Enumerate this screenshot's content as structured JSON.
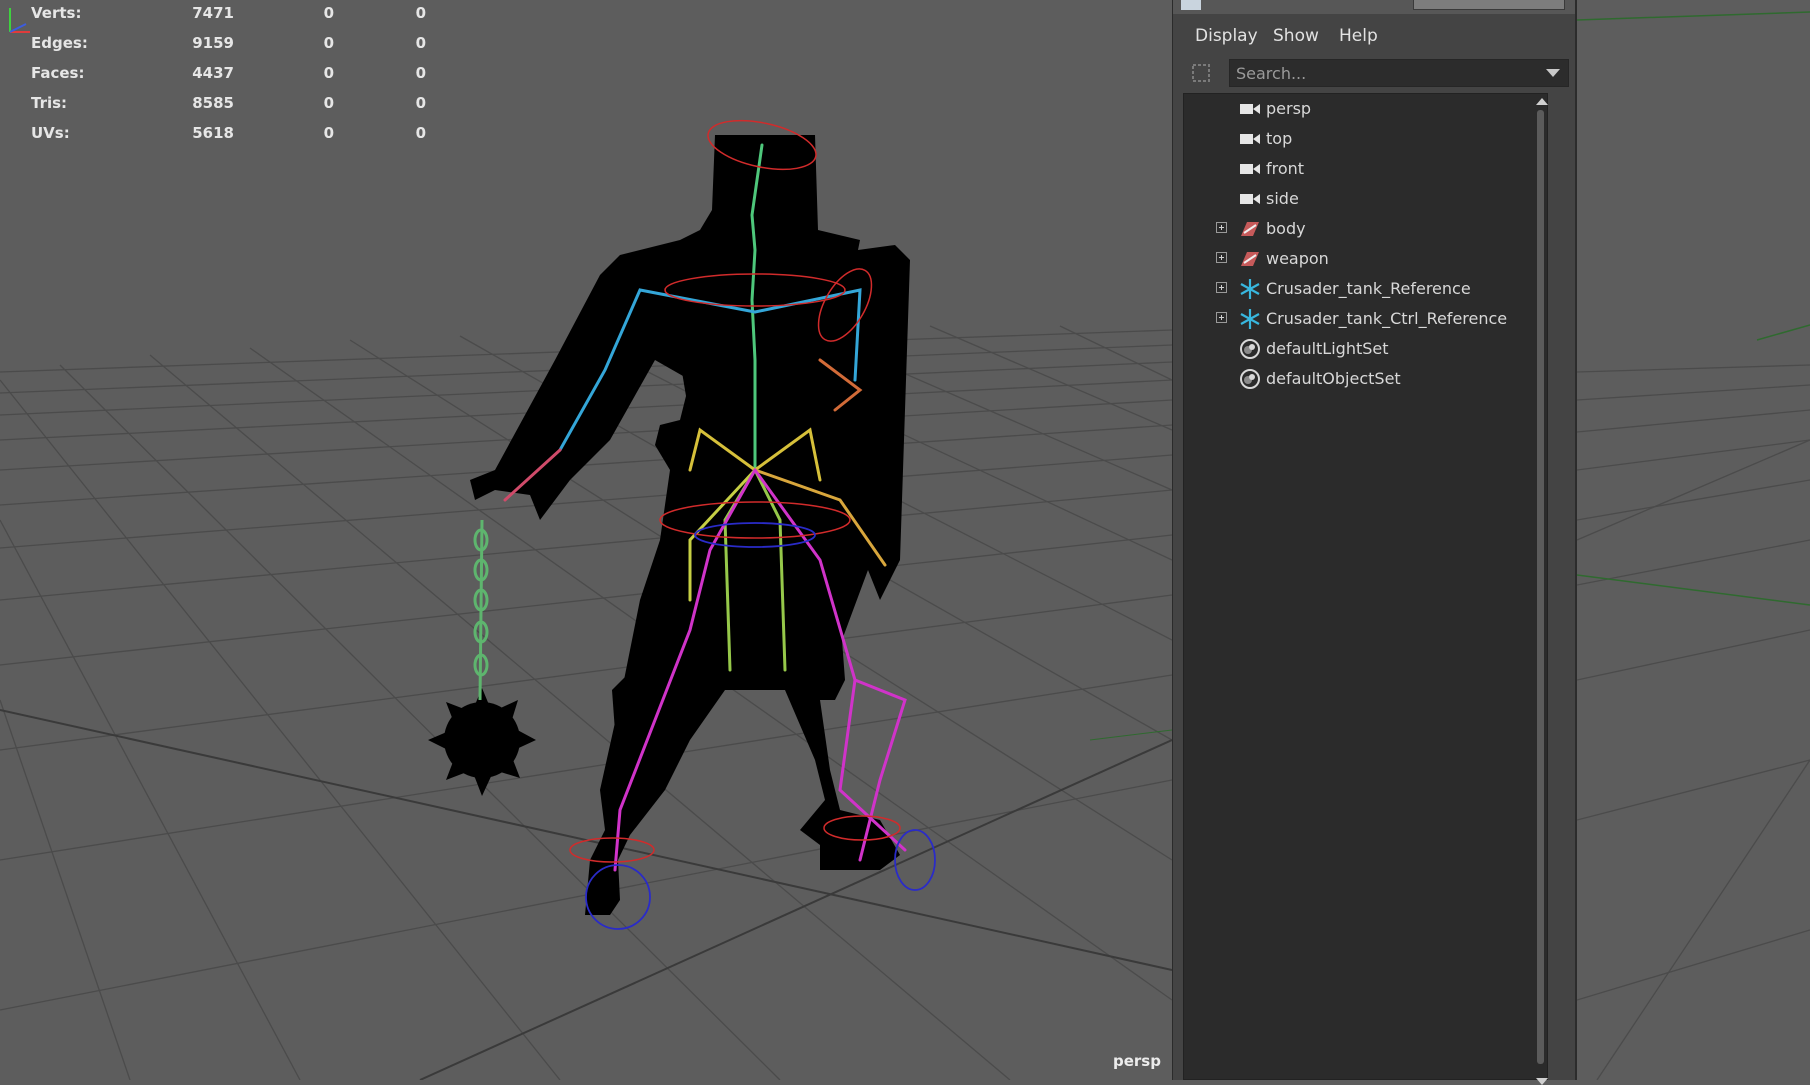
{
  "stats": [
    {
      "label": "Verts:",
      "v1": "7471",
      "v2": "0",
      "v3": "0"
    },
    {
      "label": "Edges:",
      "v1": "9159",
      "v2": "0",
      "v3": "0"
    },
    {
      "label": "Faces:",
      "v1": "4437",
      "v2": "0",
      "v3": "0"
    },
    {
      "label": "Tris:",
      "v1": "8585",
      "v2": "0",
      "v3": "0"
    },
    {
      "label": "UVs:",
      "v1": "5618",
      "v2": "0",
      "v3": "0"
    }
  ],
  "viewport": {
    "camera_label": "persp"
  },
  "outliner": {
    "menu": {
      "display": "Display",
      "show": "Show",
      "help": "Help"
    },
    "search": {
      "placeholder": "Search..."
    },
    "items": [
      {
        "label": "persp",
        "icon": "camera-icon"
      },
      {
        "label": "top",
        "icon": "camera-icon"
      },
      {
        "label": "front",
        "icon": "camera-icon"
      },
      {
        "label": "side",
        "icon": "camera-icon"
      },
      {
        "label": "body",
        "icon": "mesh-group-icon"
      },
      {
        "label": "weapon",
        "icon": "mesh-group-icon"
      },
      {
        "label": "Crusader_tank_Reference",
        "icon": "reference-icon"
      },
      {
        "label": "Crusader_tank_Ctrl_Reference",
        "icon": "reference-icon"
      },
      {
        "label": "defaultLightSet",
        "icon": "set-icon"
      },
      {
        "label": "defaultObjectSet",
        "icon": "set-icon"
      }
    ]
  }
}
